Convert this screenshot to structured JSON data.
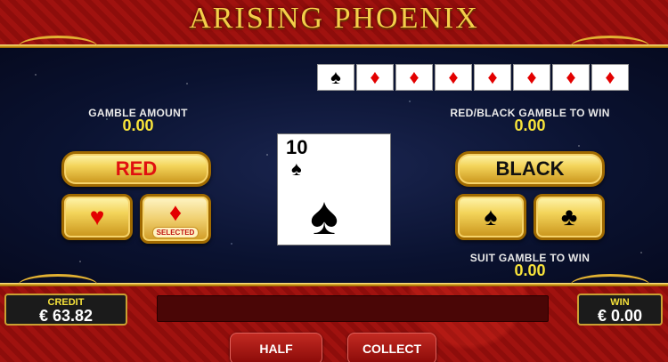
{
  "title": "ARISING PHOENIX",
  "history": [
    {
      "suit": "♠",
      "color": "black"
    },
    {
      "suit": "♦",
      "color": "red"
    },
    {
      "suit": "♦",
      "color": "red"
    },
    {
      "suit": "♦",
      "color": "red"
    },
    {
      "suit": "♦",
      "color": "red"
    },
    {
      "suit": "♦",
      "color": "red"
    },
    {
      "suit": "♦",
      "color": "red"
    },
    {
      "suit": "♦",
      "color": "red"
    }
  ],
  "gamble_amount": {
    "label": "GAMBLE AMOUNT",
    "value": "0.00"
  },
  "red_black": {
    "label": "RED/BLACK GAMBLE TO WIN",
    "value": "0.00"
  },
  "suit_gamble": {
    "label": "SUIT GAMBLE TO WIN",
    "value": "0.00"
  },
  "buttons": {
    "red": "RED",
    "black": "BLACK",
    "heart": "♥",
    "diamond": "♦",
    "diamond_selected": "SELECTED",
    "spade": "♠",
    "club": "♣",
    "half": "HALF",
    "collect": "COLLECT"
  },
  "current_card": {
    "rank": "10",
    "suit": "♠"
  },
  "credit": {
    "label": "CREDIT",
    "value": "€ 63.82"
  },
  "win": {
    "label": "WIN",
    "value": "€ 0.00"
  },
  "colors": {
    "gold": "#f4cf4a",
    "red_suit": "#e30000",
    "value_yellow": "#f6e23a"
  }
}
